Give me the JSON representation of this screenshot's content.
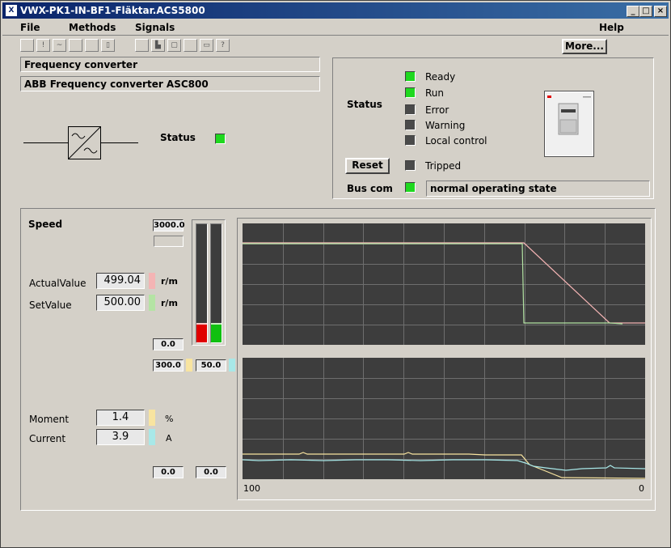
{
  "window": {
    "title": "VWX-PK1-IN-BF1-Fläktar.ACS5800"
  },
  "menu": {
    "file": "File",
    "methods": "Methods",
    "signals": "Signals",
    "help": "Help"
  },
  "toolbar": {
    "more_label": "More..."
  },
  "header": {
    "name": "Frequency converter",
    "description": "ABB Frequency converter ASC800",
    "status_label": "Status"
  },
  "status_panel": {
    "title": "Status",
    "indicators": [
      {
        "label": "Ready",
        "on": true
      },
      {
        "label": "Run",
        "on": true
      },
      {
        "label": "Error",
        "on": false
      },
      {
        "label": "Warning",
        "on": false
      },
      {
        "label": "Local control",
        "on": false
      }
    ],
    "reset_label": "Reset",
    "tripped_label": "Tripped",
    "buscom_label": "Bus com",
    "buscom_text": "normal operating state"
  },
  "speed": {
    "title": "Speed",
    "max": "3000.0",
    "min": "0.0",
    "actual_label": "ActualValue",
    "actual_value": "499.04",
    "actual_unit": "r/m",
    "set_label": "SetValue",
    "set_value": "500.00",
    "set_unit": "r/m",
    "actual_fraction": 0.166,
    "set_fraction": 0.167,
    "scale_moment": "300.0",
    "scale_current": "50.0"
  },
  "moment": {
    "label": "Moment",
    "value": "1.4",
    "unit": "%",
    "min": "0.0"
  },
  "current": {
    "label": "Current",
    "value": "3.9",
    "unit": "A",
    "min": "0.0"
  },
  "trend": {
    "x_left": "100",
    "x_right": "0"
  },
  "colors": {
    "actual": "#f4b4b4",
    "setvalue": "#b4e4a4",
    "moment": "#f8e4a0",
    "current": "#a8e8e8",
    "led_on": "#1fd81f",
    "led_off": "#4a4a4a"
  }
}
